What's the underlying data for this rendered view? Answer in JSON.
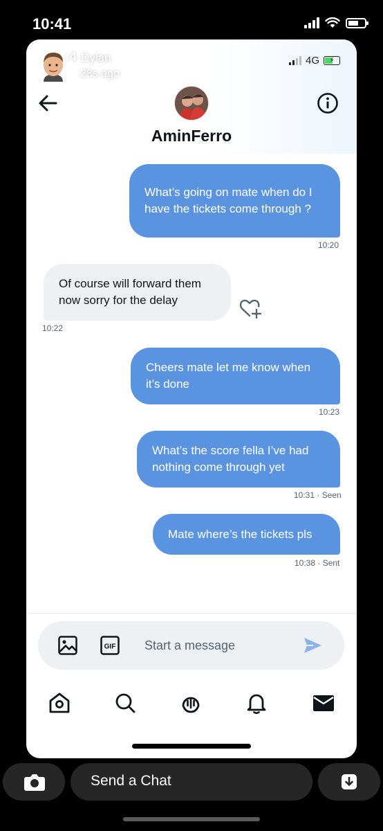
{
  "outer": {
    "time": "10:41"
  },
  "snap_overlay": {
    "clock": ":4",
    "name": "Dylan",
    "ago": "28s ago"
  },
  "inner_status": {
    "network": "4G"
  },
  "header": {
    "title": "AminFerro"
  },
  "messages": [
    {
      "direction": "out",
      "text": "What’s going on mate when do I have the tickets come through ?",
      "time": "10:20"
    },
    {
      "direction": "in",
      "text": "Of course will forward them now sorry for the delay",
      "time": "10:22"
    },
    {
      "direction": "out",
      "text": "Cheers mate let me know when it’s done",
      "time": "10:23"
    },
    {
      "direction": "out",
      "text": "What’s the score fella I’ve had nothing come through yet",
      "time": "10:31 · Seen"
    },
    {
      "direction": "out",
      "text": "Mate where’s the tickets pls",
      "time": "10:38 · Sent"
    }
  ],
  "composer": {
    "placeholder": "Start a message",
    "gif_label": "GIF"
  },
  "nav": [
    "home-icon",
    "search-icon",
    "spaces-icon",
    "notifications-icon",
    "messages-icon"
  ],
  "snap_bottom": {
    "chat_label": "Send a Chat"
  },
  "colors": {
    "accent": "#5a93e0",
    "incoming": "#eef1f4",
    "snap_bar": "#262626"
  }
}
